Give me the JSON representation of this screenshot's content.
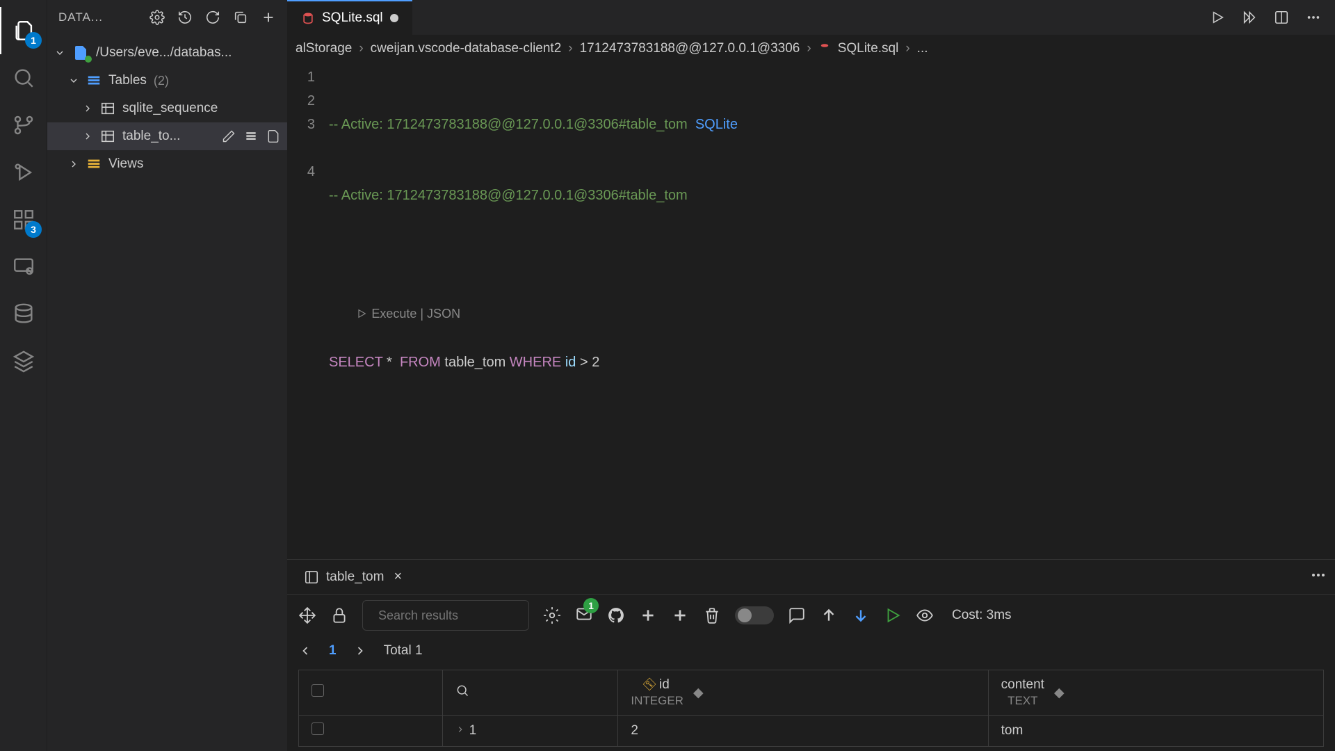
{
  "activityBar": {
    "filesBadge": "1",
    "extensionsBadge": "3"
  },
  "sidebar": {
    "title": "DATA...",
    "connection": "/Users/eve.../databas...",
    "tables": {
      "label": "Tables",
      "count": "(2)"
    },
    "tableItems": [
      "sqlite_sequence",
      "table_to..."
    ],
    "views": "Views"
  },
  "editor": {
    "tab": "SQLite.sql",
    "breadcrumb": [
      "alStorage",
      "cweijan.vscode-database-client2",
      "1712473783188@@127.0.0.1@3306",
      "SQLite.sql",
      "..."
    ],
    "lines": {
      "l1_comment": "-- Active: 1712473783188@@127.0.0.1@3306#table_tom",
      "l1_link": "SQLite",
      "l2_comment": "-- Active: 1712473783188@@127.0.0.1@3306#table_tom",
      "codelens": "Execute | JSON",
      "select": "SELECT",
      "star": "*",
      "from": "FROM",
      "table": "table_tom",
      "where": "WHERE",
      "id": "id",
      "gt": ">",
      "val": "2"
    }
  },
  "results": {
    "tab": "table_tom",
    "searchPlaceholder": "Search results",
    "mailBadge": "1",
    "cost": "Cost: 3ms",
    "pagination": {
      "page": "1",
      "total": "Total 1"
    },
    "columns": [
      {
        "name": "id",
        "type": "INTEGER",
        "pk": true
      },
      {
        "name": "content",
        "type": "TEXT",
        "pk": false
      }
    ],
    "rows": [
      {
        "rownum": "1",
        "id": "2",
        "content": "tom"
      }
    ]
  }
}
